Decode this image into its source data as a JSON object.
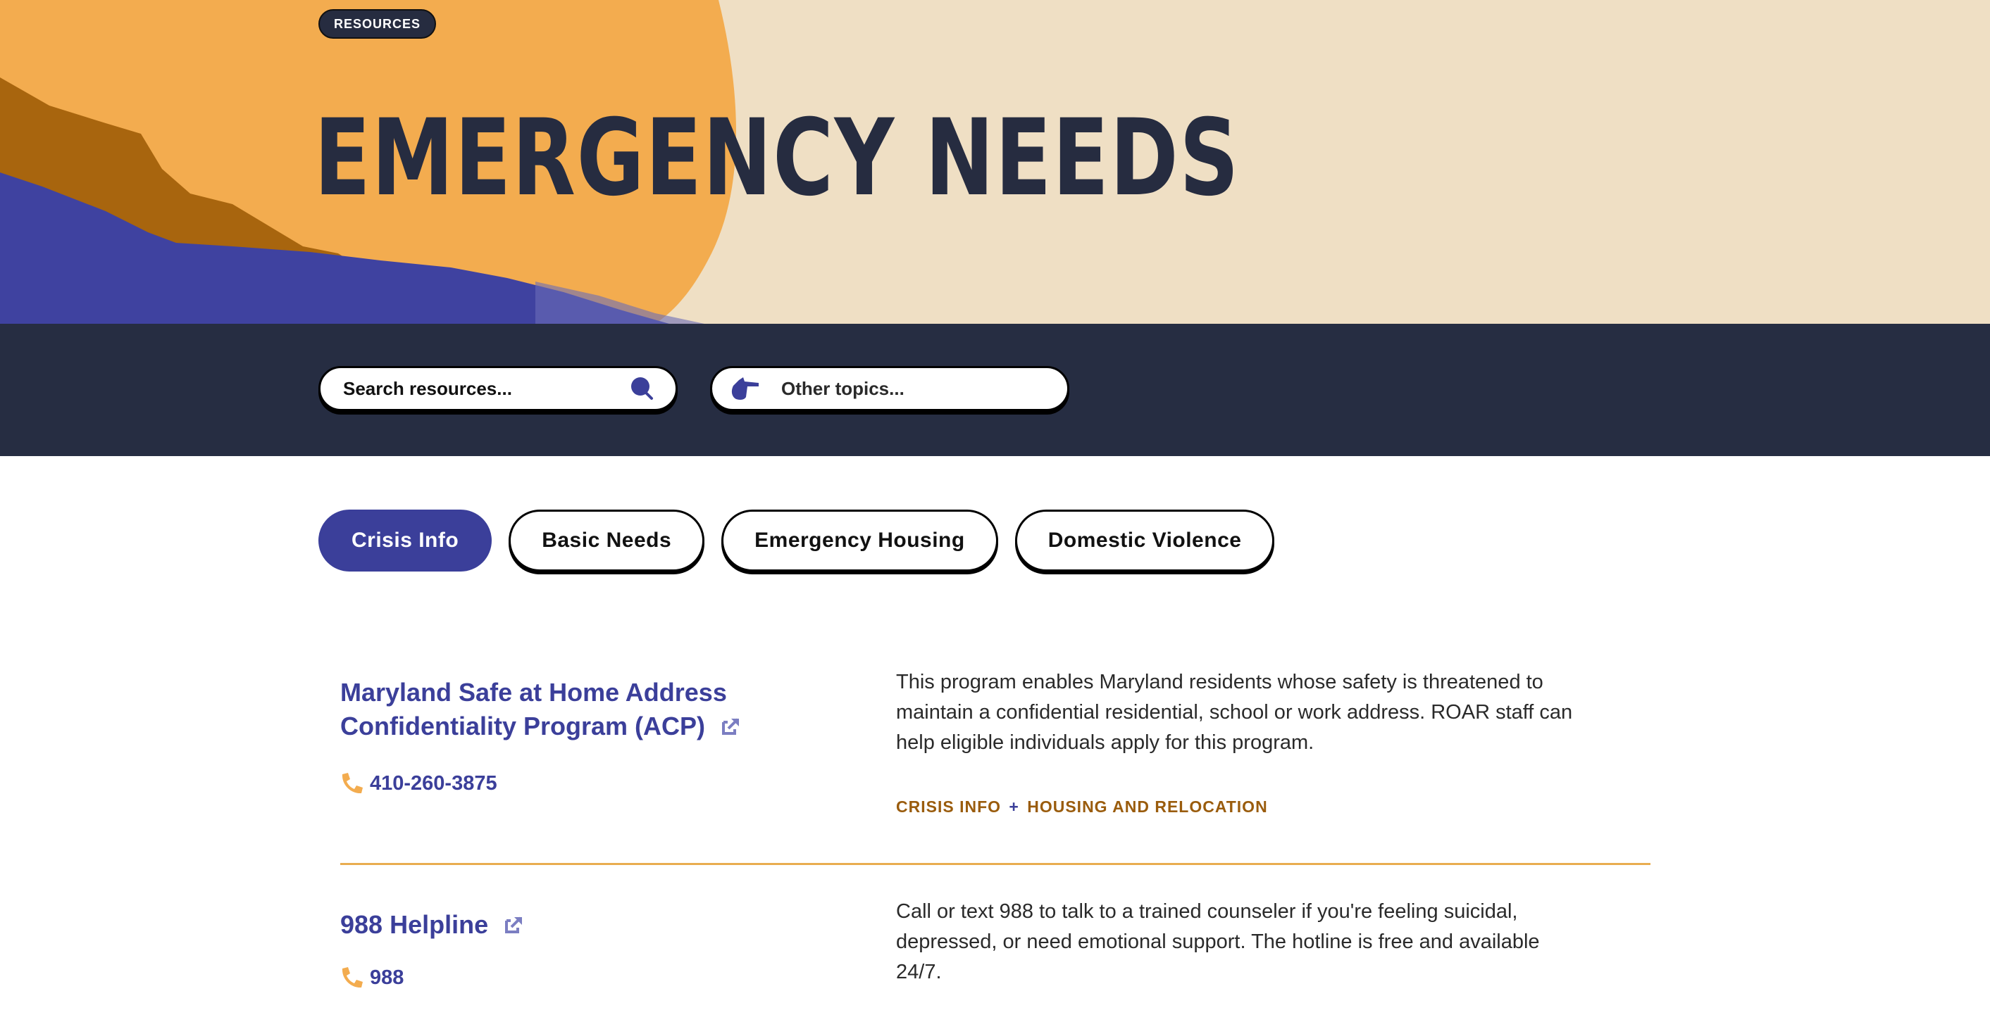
{
  "hero": {
    "badge": "RESOURCES",
    "title": "EMERGENCY NEEDS"
  },
  "toolbar": {
    "search_placeholder": "Search resources...",
    "topics_placeholder": "Other topics..."
  },
  "tabs": [
    {
      "label": "Crisis Info",
      "active": true
    },
    {
      "label": "Basic Needs",
      "active": false
    },
    {
      "label": "Emergency Housing",
      "active": false
    },
    {
      "label": "Domestic Violence",
      "active": false
    }
  ],
  "resources": [
    {
      "title_line1": "Maryland Safe at Home Address",
      "title_line2": "Confidentiality Program (ACP)",
      "phone": "410-260-3875",
      "description": "This program enables Maryland residents whose safety is threatened to maintain a confidential residential, school or work address. ROAR staff can help eligible individuals apply for this program.",
      "tags": [
        "CRISIS INFO",
        "HOUSING AND RELOCATION"
      ],
      "tag_separator": "+"
    },
    {
      "title_line1": "988 Helpline",
      "phone": "988",
      "description": "Call or text 988 to talk to a trained counseler if you're feeling suicidal, depressed, or need emotional support. The hotline is free and available 24/7."
    }
  ],
  "icons": {
    "search": "search-icon",
    "topics": "pointing-hand-icon",
    "external": "external-link-icon",
    "phone": "phone-icon"
  },
  "colors": {
    "navy": "#262c40",
    "indigo": "#3b3f9a",
    "orange": "#f3ac4f",
    "cream": "#efdfc4",
    "tag_brown": "#9a5c0d",
    "divider": "#e9ad50"
  }
}
